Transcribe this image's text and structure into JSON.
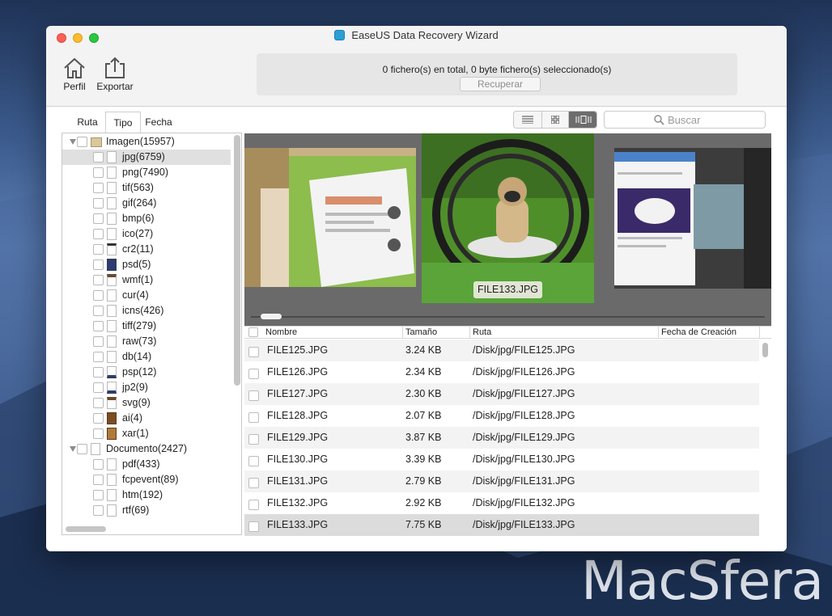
{
  "window": {
    "title": "EaseUS Data Recovery Wizard"
  },
  "toolbar": {
    "profile_label": "Perfil",
    "export_label": "Exportar"
  },
  "summary": {
    "status_text": "0 fichero(s) en total, 0 byte  fichero(s) seleccionado(s)",
    "recover_label": "Recuperar"
  },
  "tabs": [
    {
      "label": "Ruta",
      "active": false
    },
    {
      "label": "Tipo",
      "active": true
    },
    {
      "label": "Fecha",
      "active": false
    }
  ],
  "view_modes": [
    {
      "icon": "list-view-icon",
      "selected": false
    },
    {
      "icon": "grid-view-icon",
      "selected": false
    },
    {
      "icon": "coverflow-view-icon",
      "selected": true
    }
  ],
  "search": {
    "placeholder": "Buscar"
  },
  "tree": {
    "groups": [
      {
        "label": "Imagen(15957)",
        "items": [
          {
            "label": "jpg(6759)",
            "selected": true
          },
          {
            "label": "png(7490)"
          },
          {
            "label": "tif(563)"
          },
          {
            "label": "gif(264)"
          },
          {
            "label": "bmp(6)"
          },
          {
            "label": "ico(27)"
          },
          {
            "label": "cr2(11)"
          },
          {
            "label": "psd(5)"
          },
          {
            "label": "wmf(1)"
          },
          {
            "label": "cur(4)"
          },
          {
            "label": "icns(426)"
          },
          {
            "label": "tiff(279)"
          },
          {
            "label": "raw(73)"
          },
          {
            "label": "db(14)"
          },
          {
            "label": "psp(12)"
          },
          {
            "label": "jp2(9)"
          },
          {
            "label": "svg(9)"
          },
          {
            "label": "ai(4)"
          },
          {
            "label": "xar(1)"
          }
        ]
      },
      {
        "label": "Documento(2427)",
        "items": [
          {
            "label": "pdf(433)"
          },
          {
            "label": "fcpevent(89)"
          },
          {
            "label": "htm(192)"
          },
          {
            "label": "rtf(69)"
          }
        ]
      }
    ]
  },
  "gallery": {
    "caption": "FILE133.JPG"
  },
  "table": {
    "columns": [
      "Nombre",
      "Tamaño",
      "Ruta",
      "Fecha de Creación"
    ],
    "rows": [
      {
        "name": "FILE125.JPG",
        "size": "3.24 KB",
        "path": "/Disk/jpg/FILE125.JPG",
        "date": ""
      },
      {
        "name": "FILE126.JPG",
        "size": "2.34 KB",
        "path": "/Disk/jpg/FILE126.JPG",
        "date": ""
      },
      {
        "name": "FILE127.JPG",
        "size": "2.30 KB",
        "path": "/Disk/jpg/FILE127.JPG",
        "date": ""
      },
      {
        "name": "FILE128.JPG",
        "size": "2.07 KB",
        "path": "/Disk/jpg/FILE128.JPG",
        "date": ""
      },
      {
        "name": "FILE129.JPG",
        "size": "3.87 KB",
        "path": "/Disk/jpg/FILE129.JPG",
        "date": ""
      },
      {
        "name": "FILE130.JPG",
        "size": "3.39 KB",
        "path": "/Disk/jpg/FILE130.JPG",
        "date": ""
      },
      {
        "name": "FILE131.JPG",
        "size": "2.79 KB",
        "path": "/Disk/jpg/FILE131.JPG",
        "date": ""
      },
      {
        "name": "FILE132.JPG",
        "size": "2.92 KB",
        "path": "/Disk/jpg/FILE132.JPG",
        "date": ""
      },
      {
        "name": "FILE133.JPG",
        "size": "7.75 KB",
        "path": "/Disk/jpg/FILE133.JPG",
        "date": "",
        "highlighted": true
      }
    ]
  },
  "desktop": {
    "watermark": "MacSfera"
  }
}
